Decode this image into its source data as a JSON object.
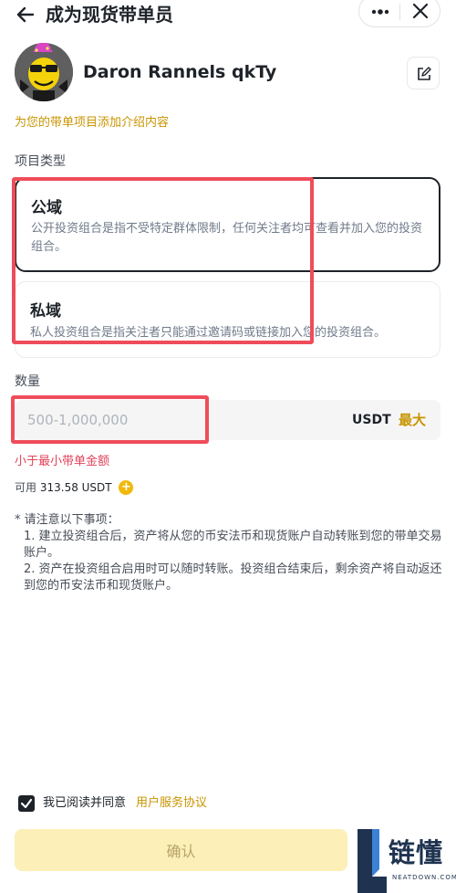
{
  "header": {
    "title": "成为现货带单员",
    "back_icon": "arrow-left-icon",
    "more_icon": "more-dots-icon",
    "close_icon": "close-icon"
  },
  "profile": {
    "name": "Daron Rannels qkTy",
    "avatar_icon": "avatar-cartoon-icon",
    "edit_icon": "edit-icon"
  },
  "intro_link": "为您的带单项目添加介绍内容",
  "project_type": {
    "label": "项目类型",
    "options": [
      {
        "title": "公域",
        "desc": "公开投资组合是指不受特定群体限制，任何关注者均可查看并加入您的投资组合。",
        "selected": true
      },
      {
        "title": "私域",
        "desc": "私人投资组合是指关注者只能通过邀请码或链接加入您的投资组合。",
        "selected": false
      }
    ]
  },
  "amount": {
    "label": "数量",
    "value": "",
    "placeholder": "500-1,000,000",
    "unit": "USDT",
    "max_label": "最大",
    "error": "小于最小带单金额"
  },
  "available": {
    "label": "可用",
    "value": "313.58 USDT",
    "add_icon": "plus-circle-icon"
  },
  "notes": {
    "heading": "* 请注意以下事项：",
    "items": [
      "1. 建立投资组合后，资产将从您的币安法币和现货账户自动转账到您的带单交易账户。",
      "2. 资产在投资组合启用时可以随时转账。投资组合结束后，剩余资产将自动返还到您的币安法币和现货账户。"
    ]
  },
  "agreement": {
    "checked": true,
    "text": "我已阅读并同意",
    "link": "用户服务协议"
  },
  "confirm_label": "确认",
  "watermark": {
    "text": "链懂",
    "sub": "NEATDOWN.COM"
  },
  "colors": {
    "brand_yellow": "#f0b90b",
    "link_gold": "#c99400",
    "error_red": "#e0435a",
    "annotation_red": "#ef4c5a",
    "text_primary": "#1e2329"
  }
}
